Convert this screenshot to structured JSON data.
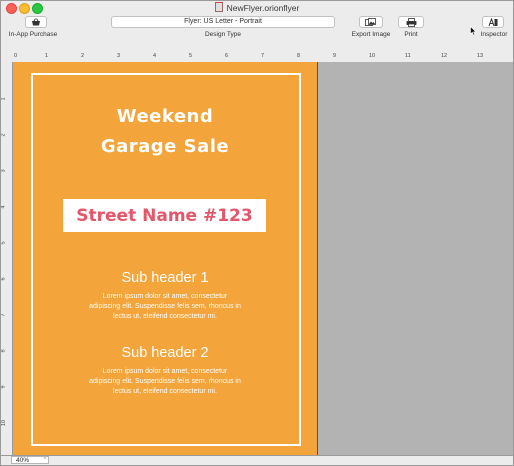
{
  "window": {
    "title": "NewFlyer.orionflyer"
  },
  "toolbar": {
    "in_app_purchase": "In-App Purchase",
    "design_type_value": "Flyer: US Letter - Portrait",
    "design_type_label": "Design Type",
    "export_image": "Export Image",
    "print": "Print",
    "inspector": "Inspector"
  },
  "ruler": {
    "top": [
      "0",
      "1",
      "2",
      "3",
      "4",
      "5",
      "6",
      "7",
      "8",
      "9",
      "10",
      "11",
      "12",
      "13"
    ],
    "left": [
      "1",
      "2",
      "3",
      "4",
      "5",
      "6",
      "7",
      "8",
      "9",
      "10"
    ]
  },
  "flyer": {
    "headline1": "Weekend",
    "headline2": "Garage Sale",
    "street": "Street Name #123",
    "sub1": "Sub header 1",
    "body1": "Lorem ipsum dolor sit amet, consectetur adipiscing elit. Suspendisse felis sem, rhoncus in lectus ut, eleifend consectetur mi.",
    "sub2": "Sub header 2",
    "body2": "Lorem ipsum dolor sit amet, consectetur adipiscing elit. Suspendisse felis sem, rhoncus in lectus ut, eleifend consectetur mi.",
    "background_color": "#f3a43a",
    "accent_color": "#e4566a"
  },
  "status": {
    "zoom": "40%"
  },
  "icons": [
    "basket-icon",
    "export-image-icon",
    "printer-icon",
    "inspector-icon",
    "document-icon",
    "chevron-updown-icon"
  ]
}
